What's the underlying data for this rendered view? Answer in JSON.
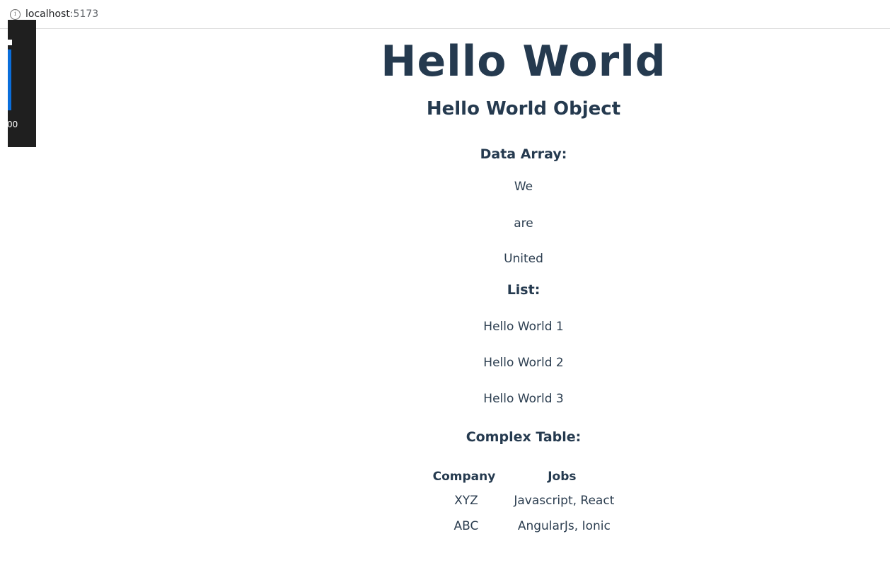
{
  "browser": {
    "url_host": "localhost",
    "url_port": ":5173"
  },
  "overlay": {
    "label": "00"
  },
  "page": {
    "title": "Hello World",
    "subtitle": "Hello World Object",
    "data_array": {
      "heading": "Data Array:",
      "items": [
        "We",
        "are",
        "United"
      ]
    },
    "list": {
      "heading": "List:",
      "items": [
        "Hello World 1",
        "Hello World 2",
        "Hello World 3"
      ]
    },
    "complex_table": {
      "heading": "Complex Table:",
      "columns": [
        "Company",
        "Jobs"
      ],
      "rows": [
        [
          "XYZ",
          "Javascript, React"
        ],
        [
          "ABC",
          "AngularJs, Ionic"
        ]
      ]
    }
  }
}
